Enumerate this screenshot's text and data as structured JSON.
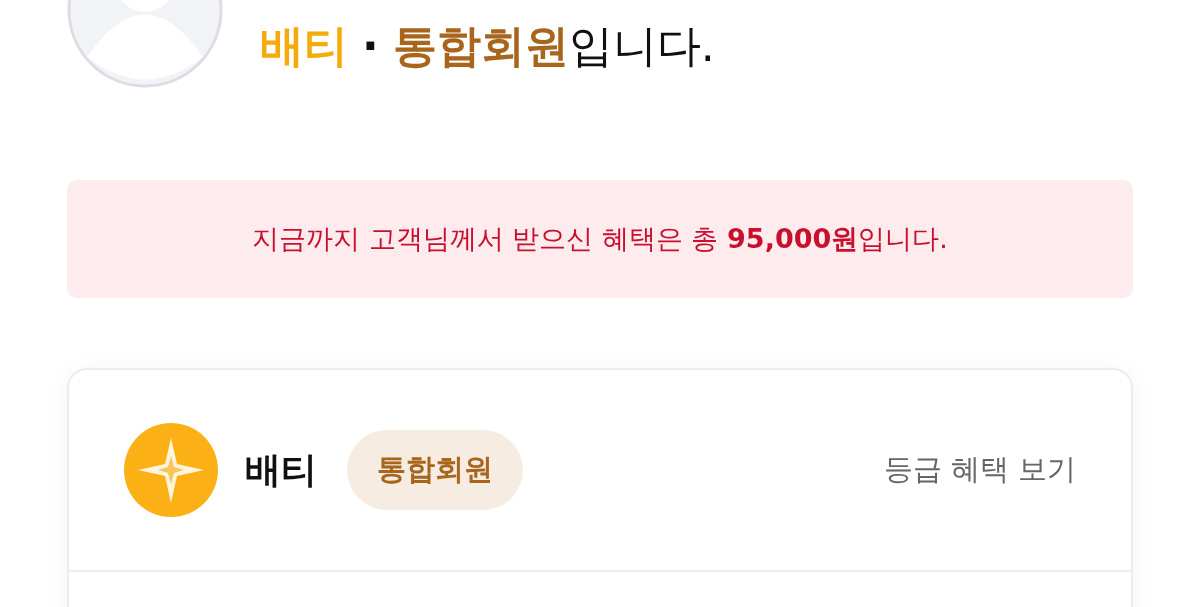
{
  "profile": {
    "heading": {
      "grade": "배티",
      "separator": "·",
      "membership": "통합회원",
      "suffix": "입니다."
    }
  },
  "benefit_banner": {
    "text": "지금까지 고객님께서 받으신 혜택은 총 **95,000원**입니다."
  },
  "grade_card": {
    "grade": "배티",
    "membership_badge": "통합회원",
    "link": "등급 혜택 보기"
  }
}
